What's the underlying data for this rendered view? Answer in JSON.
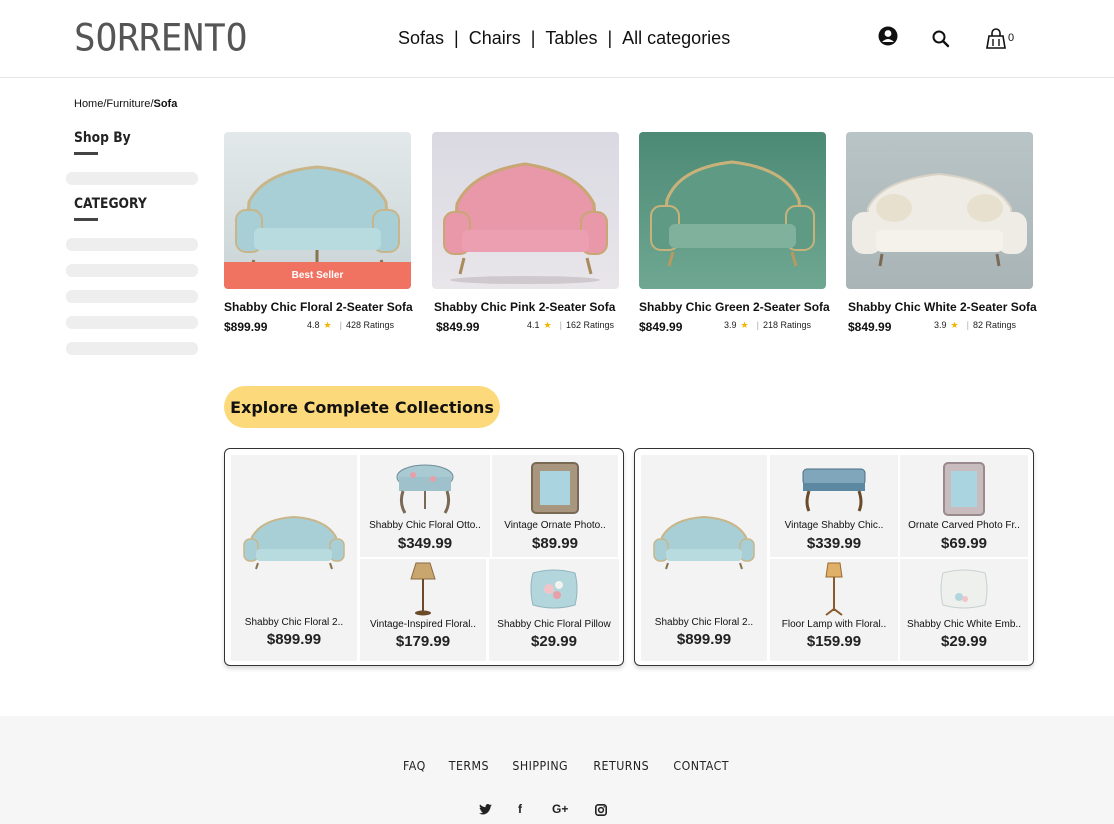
{
  "header": {
    "logo": "SORRENTO",
    "nav": [
      "Sofas",
      "Chairs",
      "Tables",
      "All categories"
    ],
    "nav_separator": "|",
    "cart_count": "0"
  },
  "breadcrumb": {
    "home": "Home",
    "furniture": "Furniture",
    "current": "Sofa",
    "sep": "/"
  },
  "sidebar": {
    "shop_by": "Shop By",
    "category": "CATEGORY"
  },
  "products": [
    {
      "title": "Shabby Chic Floral 2-Seater Sofa",
      "price": "$899.99",
      "rating": "4.8",
      "ratings_count": "428 Ratings",
      "badge": "Best Seller",
      "color": "#a9cfd6"
    },
    {
      "title": "Shabby Chic Pink 2-Seater Sofa",
      "price": "$849.99",
      "rating": "4.1",
      "ratings_count": "162 Ratings",
      "color": "#e898a8"
    },
    {
      "title": "Shabby Chic Green 2-Seater Sofa",
      "price": "$849.99",
      "rating": "3.9",
      "ratings_count": "218 Ratings",
      "color": "#5f9a84"
    },
    {
      "title": "Shabby Chic White 2-Seater Sofa",
      "price": "$849.99",
      "rating": "3.9",
      "ratings_count": "82 Ratings",
      "color": "#e9e5dc"
    }
  ],
  "explore_label": "Explore Complete Collections",
  "collections": [
    {
      "main": {
        "name": "Shabby Chic Floral 2..",
        "price": "$899.99"
      },
      "items": [
        {
          "name": "Shabby Chic Floral Otto..",
          "price": "$349.99"
        },
        {
          "name": "Vintage Ornate Photo..",
          "price": "$89.99"
        },
        {
          "name": "Vintage-Inspired Floral..",
          "price": "$179.99"
        },
        {
          "name": "Shabby Chic Floral Pillow",
          "price": "$29.99"
        }
      ]
    },
    {
      "main": {
        "name": "Shabby Chic Floral 2..",
        "price": "$899.99"
      },
      "items": [
        {
          "name": "Vintage Shabby Chic..",
          "price": "$339.99"
        },
        {
          "name": "Ornate Carved Photo Fr..",
          "price": "$69.99"
        },
        {
          "name": "Floor Lamp with Floral..",
          "price": "$159.99"
        },
        {
          "name": "Shabby Chic White Emb..",
          "price": "$29.99"
        }
      ]
    }
  ],
  "footer": {
    "links": [
      "FAQ",
      "TERMS",
      "SHIPPING",
      "RETURNS",
      "CONTACT"
    ],
    "social": [
      "twitter-icon",
      "facebook-icon",
      "google-plus-icon",
      "instagram-icon"
    ],
    "social_glyphs": {
      "twitter": "🐦",
      "facebook": "f",
      "gplus": "G+",
      "instagram": "◘"
    }
  },
  "colors": {
    "accent": "#fcd97a",
    "badge": "#f07362",
    "star": "#f5b400"
  }
}
